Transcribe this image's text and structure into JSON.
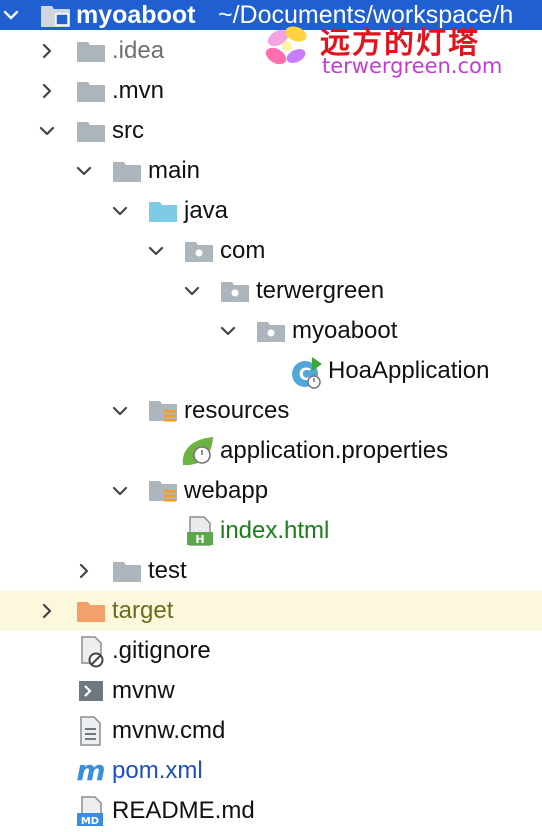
{
  "header": {
    "project_name": "myoaboot",
    "project_path": "~/Documents/workspace/h"
  },
  "watermark": {
    "chinese_text": "远方的灯塔",
    "url_text": "terwergreen.com"
  },
  "tree": {
    "idea": ".idea",
    "mvn": ".mvn",
    "src": "src",
    "main": "main",
    "java": "java",
    "com": "com",
    "terwergreen": "terwergreen",
    "myoaboot": "myoaboot",
    "hoa_application": "HoaApplication",
    "resources": "resources",
    "application_properties": "application.properties",
    "webapp": "webapp",
    "index_html": "index.html",
    "test": "test",
    "target": "target",
    "gitignore": ".gitignore",
    "mvnw": "mvnw",
    "mvnw_cmd": "mvnw.cmd",
    "pom_xml": "pom.xml",
    "readme_md": "README.md"
  },
  "colors": {
    "selection": "#1f5fcf",
    "folder": "#aeb6bd",
    "source_folder": "#7ecbe8",
    "excluded_folder": "#f4a06a",
    "highlight_row": "#fbf8dc",
    "modified_text": "#1a7d1a",
    "added_text": "#1f4fbf"
  }
}
